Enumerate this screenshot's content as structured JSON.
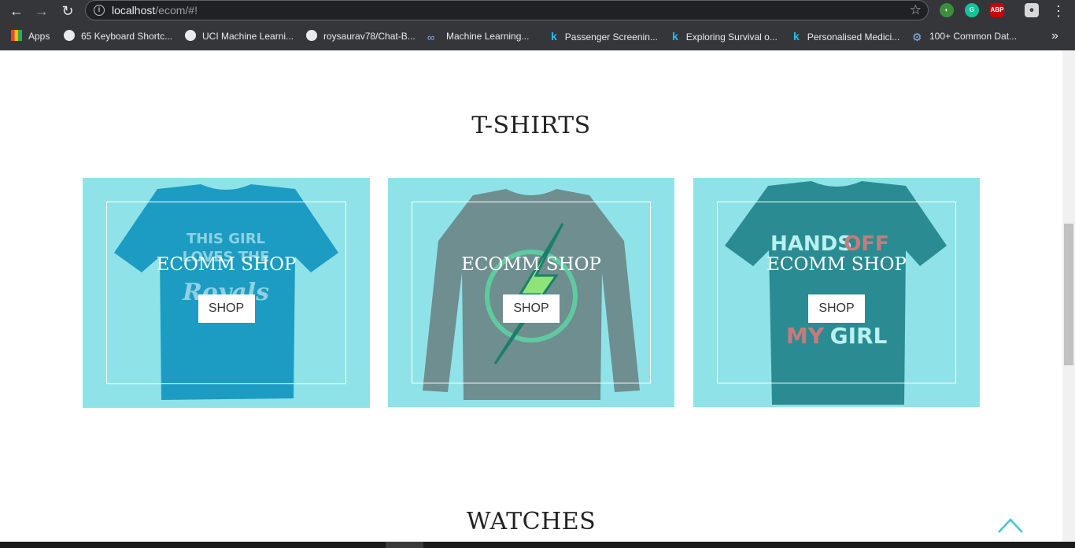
{
  "browser": {
    "url_host": "localhost",
    "url_path": "/ecom/#!",
    "bookmarks": [
      {
        "label": "Apps"
      },
      {
        "label": "65 Keyboard Shortc..."
      },
      {
        "label": "UCI Machine Learni..."
      },
      {
        "label": "roysaurav78/Chat-B..."
      },
      {
        "label": "Machine Learning..."
      },
      {
        "label": "Passenger Screenin..."
      },
      {
        "label": "Exploring Survival o..."
      },
      {
        "label": "Personalised Medici..."
      },
      {
        "label": "100+ Common Dat..."
      }
    ],
    "more_label": "»",
    "ext_abp": "ABP",
    "ext_g": "G"
  },
  "sections": [
    {
      "title": "T-SHIRTS",
      "cards": [
        {
          "brand": "ECOMM SHOP",
          "button": "SHOP",
          "shirt_text_1": "THIS GIRL",
          "shirt_text_2": "LOVES THE",
          "shirt_text_3": "Royals",
          "shirt_color": "#1c9cc2"
        },
        {
          "brand": "ECOMM SHOP",
          "button": "SHOP",
          "shirt_color": "#6e8e90"
        },
        {
          "brand": "ECOMM SHOP",
          "button": "SHOP",
          "shirt_text_1": "HANDS",
          "shirt_text_2": "OFF",
          "shirt_text_3": "MY",
          "shirt_text_4": "GIRL",
          "shirt_color": "#2a8c92"
        }
      ]
    },
    {
      "title": "WATCHES"
    }
  ],
  "colors": {
    "card_bg": "#8fe3e8",
    "accent": "#48c6c9"
  }
}
